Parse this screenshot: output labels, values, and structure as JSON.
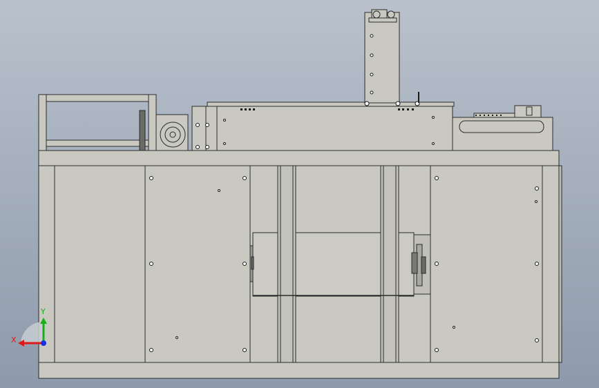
{
  "viewport": {
    "background_top": "#b8c0cc",
    "background_bottom": "#8d9aaa",
    "part_fill": "#c8c8c0",
    "part_stroke": "#2a2a2a"
  },
  "triad": {
    "x_label": "X",
    "y_label": "Y",
    "x_color": "#e01818",
    "y_color": "#18b018",
    "z_color": "#1830e0"
  }
}
